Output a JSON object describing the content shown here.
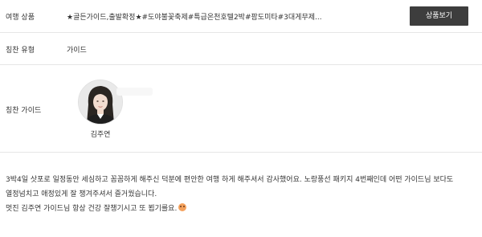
{
  "product": {
    "label": "여행 상품",
    "value": "★골든가이드,출발확정★#도야불꽃축제#특급온천호텔2박#팜도미타#3대게무제...",
    "button_label": "상품보기"
  },
  "type": {
    "label": "칭찬 유형",
    "value": "가이드"
  },
  "guide": {
    "label": "칭찬 가이드",
    "name": "김주연",
    "avatar_icon": "guide-portrait"
  },
  "review": {
    "lines": [
      "3박4일 삿포로 일정동안 세심하고 꼼꼼하게 해주신 덕분에 편안한 여행 하게 해주셔서 감사했어요. 노랑풍선 패키지 4번째인데 어떤 가이드님 보다도",
      "열정넘치고 애정있게 잘 챙겨주셔서 즐거웠습니다.",
      "멋진 김주연 가이드님 항상 건강 잘챙기시고 또 뵙기를요."
    ],
    "emoji_icon": "smiling-face"
  }
}
